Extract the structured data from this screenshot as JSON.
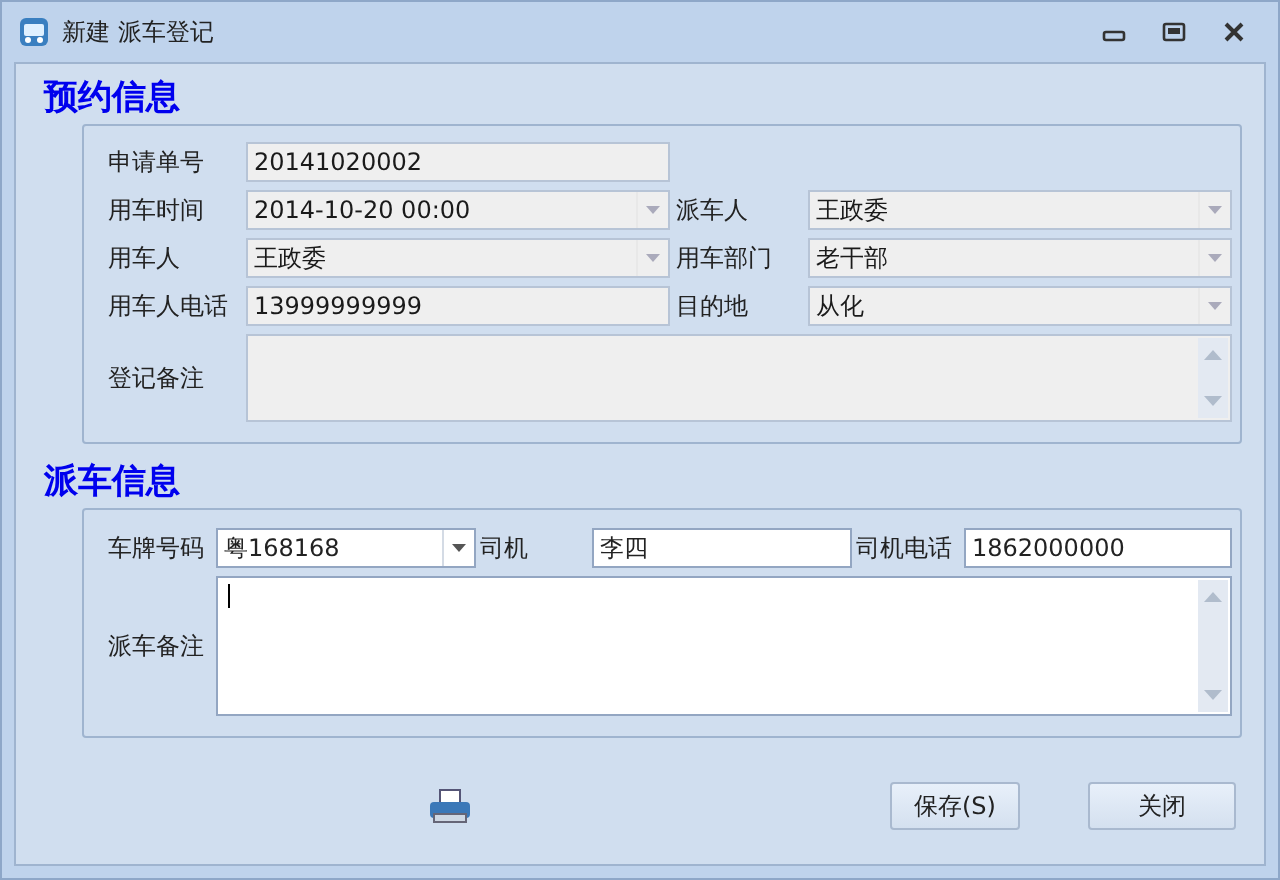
{
  "window": {
    "title": "新建 派车登记"
  },
  "sections": [
    {
      "title": "预约信息",
      "rows": [
        [
          {
            "label": "申请单号",
            "kind": "text",
            "value": "20141020002",
            "readonly": true
          }
        ],
        [
          {
            "label": "用车时间",
            "kind": "combo",
            "value": "2014-10-20 00:00",
            "readonly": true
          },
          {
            "label": "派车人",
            "kind": "combo",
            "value": "王政委",
            "readonly": true
          }
        ],
        [
          {
            "label": "用车人",
            "kind": "combo",
            "value": "王政委",
            "readonly": true
          },
          {
            "label": "用车部门",
            "kind": "combo",
            "value": "老干部",
            "readonly": true
          }
        ],
        [
          {
            "label": "用车人电话",
            "kind": "text",
            "value": "13999999999",
            "readonly": true
          },
          {
            "label": "目的地",
            "kind": "combo",
            "value": "从化",
            "readonly": true
          }
        ],
        [
          {
            "label": "登记备注",
            "kind": "memo",
            "readonly": true
          }
        ]
      ]
    },
    {
      "title": "派车信息",
      "rows": [
        [
          {
            "label": "车牌号码",
            "kind": "combo",
            "value": "粤168168",
            "readonly": false
          },
          {
            "label": "司机",
            "kind": "text",
            "value": "李四",
            "readonly": false
          },
          {
            "label": "司机电话",
            "kind": "text",
            "value": "1862000000",
            "readonly": false
          }
        ],
        [
          {
            "label": "派车备注",
            "kind": "memo",
            "readonly": false
          }
        ]
      ]
    }
  ],
  "buttons": [
    "保存(S)",
    "关闭"
  ]
}
